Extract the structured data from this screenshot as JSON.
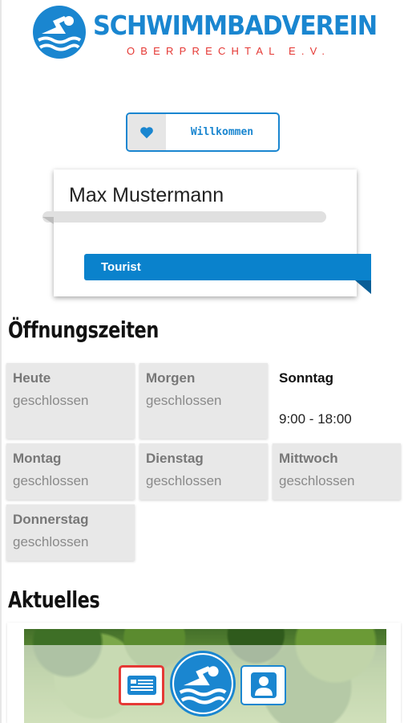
{
  "header": {
    "title": "SCHWIMMBADVEREIN",
    "subtitle": "OBERPRECHTAL E.V.",
    "logo_icon": "swimmer-logo-icon"
  },
  "welcome": {
    "label": "Willkommen",
    "icon": "heart-icon"
  },
  "profile": {
    "name": "Max Mustermann",
    "role": "Tourist"
  },
  "hours": {
    "title": "Öffnungszeiten",
    "days": [
      {
        "name": "Heute",
        "status": "geschlossen"
      },
      {
        "name": "Morgen",
        "status": "geschlossen"
      },
      {
        "name": "Sonntag",
        "status": "9:00 - 18:00"
      },
      {
        "name": "Montag",
        "status": "geschlossen"
      },
      {
        "name": "Dienstag",
        "status": "geschlossen"
      },
      {
        "name": "Mittwoch",
        "status": "geschlossen"
      },
      {
        "name": "Donnerstag",
        "status": "geschlossen"
      }
    ]
  },
  "news": {
    "title": "Aktuelles"
  },
  "bottom_nav": {
    "items": [
      {
        "icon": "news-icon",
        "active": true
      },
      {
        "icon": "swimmer-home-icon",
        "active": false
      },
      {
        "icon": "user-profile-icon",
        "active": false
      }
    ]
  },
  "colors": {
    "brand_blue": "#1a86d0",
    "accent_red": "#e53935",
    "ribbon_blue": "#0a82cc"
  }
}
